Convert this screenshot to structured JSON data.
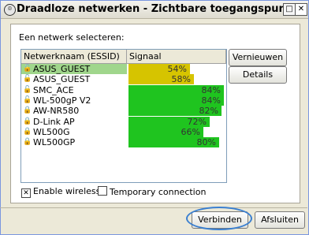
{
  "window": {
    "title": "Draadloze netwerken - Zichtbare toegangspunten"
  },
  "group": {
    "label": "Een netwerk selecteren:"
  },
  "table": {
    "columns": [
      "Netwerknaam (ESSID)",
      "Signaal"
    ],
    "rows": [
      {
        "name": "ASUS_GUEST",
        "signal": "54%",
        "signal_value": 54,
        "color": "#d6c400",
        "security": "open",
        "selected": true
      },
      {
        "name": "ASUS_GUEST",
        "signal": "58%",
        "signal_value": 58,
        "color": "#d6c400",
        "security": "open",
        "selected": false
      },
      {
        "name": "SMC_ACE",
        "signal": "84%",
        "signal_value": 84,
        "color": "#1fc41f",
        "security": "open",
        "selected": false
      },
      {
        "name": "WL-500gP V2",
        "signal": "84%",
        "signal_value": 84,
        "color": "#1fc41f",
        "security": "open",
        "selected": false
      },
      {
        "name": "AW-NR580",
        "signal": "82%",
        "signal_value": 82,
        "color": "#1fc41f",
        "security": "locked",
        "selected": false
      },
      {
        "name": "D-Link AP",
        "signal": "72%",
        "signal_value": 72,
        "color": "#1fc41f",
        "security": "locked",
        "selected": false
      },
      {
        "name": "WL500G",
        "signal": "66%",
        "signal_value": 66,
        "color": "#1fc41f",
        "security": "locked",
        "selected": false
      },
      {
        "name": "WL500GP",
        "signal": "80%",
        "signal_value": 80,
        "color": "#1fc41f",
        "security": "locked",
        "selected": false
      }
    ]
  },
  "buttons": {
    "refresh": "Vernieuwen",
    "details": "Details",
    "connect": "Verbinden",
    "close": "Afsluiten"
  },
  "options": {
    "enable_wireless": {
      "label": "Enable wireless",
      "checked": true
    },
    "temporary_connection": {
      "label": "Temporary connection",
      "checked": false
    }
  },
  "highlight_color": "#3a7fd0"
}
